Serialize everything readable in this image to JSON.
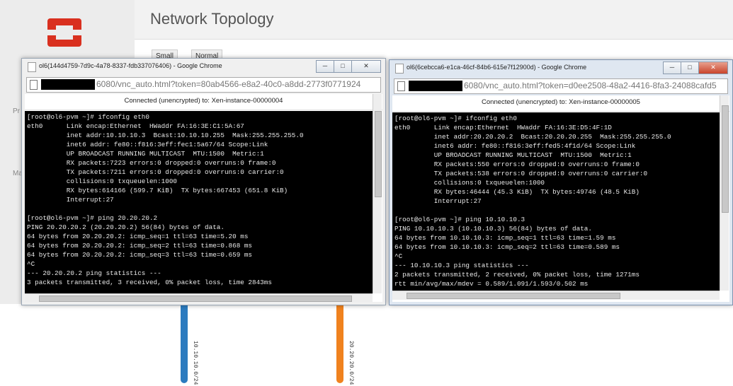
{
  "page": {
    "title": "Network Topology",
    "sidebar_fragments": [
      "Pr",
      "Ma"
    ],
    "view_toggle": {
      "small_label": "Small",
      "normal_label": "Normal"
    }
  },
  "networks": [
    {
      "label": "10.10.10.0/24",
      "color": "#2c7bbf"
    },
    {
      "label": "20.20.20.0/24",
      "color": "#f0821e"
    }
  ],
  "windows": [
    {
      "title": "ol6(144d4759-7d9c-4a78-8337-fdb337076406) - Google Chrome",
      "url": "6080/vnc_auto.html?token=80ab4566-e8a2-40c0-a8dd-2773f0771924",
      "status": "Connected (unencrypted) to: Xen-instance-00000004",
      "terminal": "[root@ol6-pvm ~]# ifconfig eth0\neth0      Link encap:Ethernet  HWaddr FA:16:3E:C1:5A:67\n          inet addr:10.10.10.3  Bcast:10.10.10.255  Mask:255.255.255.0\n          inet6 addr: fe80::f816:3eff:fec1:5a67/64 Scope:Link\n          UP BROADCAST RUNNING MULTICAST  MTU:1500  Metric:1\n          RX packets:7223 errors:0 dropped:0 overruns:0 frame:0\n          TX packets:7211 errors:0 dropped:0 overruns:0 carrier:0\n          collisions:0 txqueuelen:1000\n          RX bytes:614166 (599.7 KiB)  TX bytes:667453 (651.8 KiB)\n          Interrupt:27\n\n[root@ol6-pvm ~]# ping 20.20.20.2\nPING 20.20.20.2 (20.20.20.2) 56(84) bytes of data.\n64 bytes from 20.20.20.2: icmp_seq=1 ttl=63 time=5.20 ms\n64 bytes from 20.20.20.2: icmp_seq=2 ttl=63 time=0.868 ms\n64 bytes from 20.20.20.2: icmp_seq=3 ttl=63 time=0.659 ms\n^C\n--- 20.20.20.2 ping statistics ---\n3 packets transmitted, 3 received, 0% packet loss, time 2843ms"
    },
    {
      "title": "ol6(6cebcca6-e1ca-46cf-84b6-615e7f12900d) - Google Chrome",
      "url": "6080/vnc_auto.html?token=d0ee2508-48a2-4416-8fa3-24088cafd5",
      "status": "Connected (unencrypted) to: Xen-instance-00000005",
      "terminal": "[root@ol6-pvm ~]# ifconfig eth0\neth0      Link encap:Ethernet  HWaddr FA:16:3E:D5:4F:1D\n          inet addr:20.20.20.2  Bcast:20.20.20.255  Mask:255.255.255.0\n          inet6 addr: fe80::f816:3eff:fed5:4f1d/64 Scope:Link\n          UP BROADCAST RUNNING MULTICAST  MTU:1500  Metric:1\n          RX packets:550 errors:0 dropped:0 overruns:0 frame:0\n          TX packets:538 errors:0 dropped:0 overruns:0 carrier:0\n          collisions:0 txqueuelen:1000\n          RX bytes:46444 (45.3 KiB)  TX bytes:49746 (48.5 KiB)\n          Interrupt:27\n\n[root@ol6-pvm ~]# ping 10.10.10.3\nPING 10.10.10.3 (10.10.10.3) 56(84) bytes of data.\n64 bytes from 10.10.10.3: icmp_seq=1 ttl=63 time=1.59 ms\n64 bytes from 10.10.10.3: icmp_seq=2 ttl=63 time=0.589 ms\n^C\n--- 10.10.10.3 ping statistics ---\n2 packets transmitted, 2 received, 0% packet loss, time 1271ms\nrtt min/avg/max/mdev = 0.589/1.091/1.593/0.502 ms"
    }
  ],
  "window_buttons": {
    "minimize": "─",
    "maximize": "□",
    "close": "✕"
  },
  "colors": {
    "logo_red": "#d9301f",
    "terminal_bg": "#000000"
  }
}
